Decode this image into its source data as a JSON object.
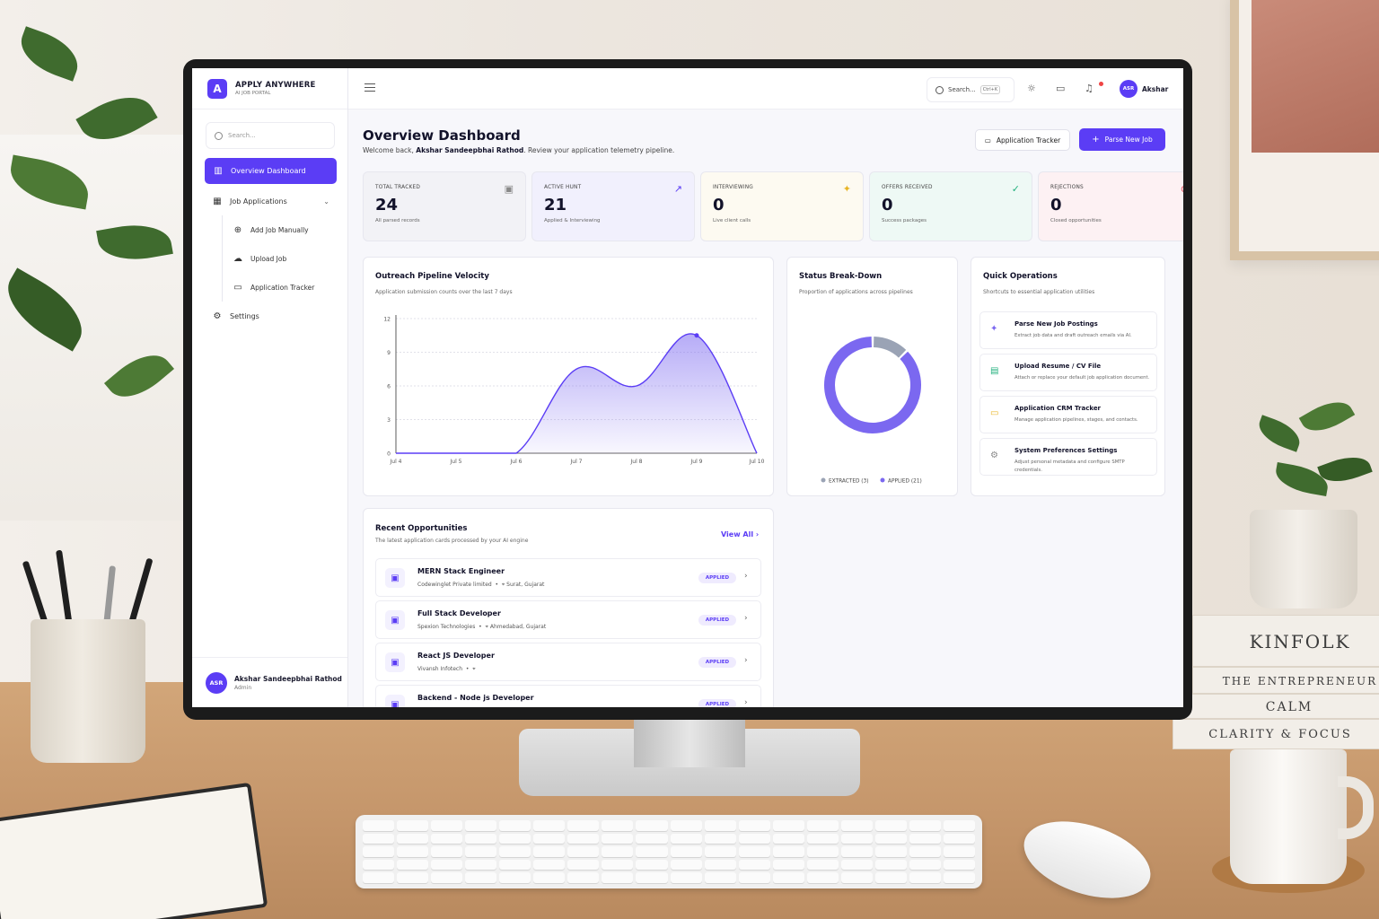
{
  "app": {
    "brand_name": "APPLY ANYWHERE",
    "brand_sub": "AI JOB PORTAL",
    "brand_letter": "A"
  },
  "sidebar": {
    "search_placeholder": "Search...",
    "items": [
      {
        "label": "Overview Dashboard",
        "icon": "bar-chart-icon",
        "active": true
      },
      {
        "label": "Job Applications",
        "icon": "grid-icon"
      },
      {
        "label": "Add Job Manually",
        "icon": "plus-circle-icon"
      },
      {
        "label": "Upload Job",
        "icon": "cloud-upload-icon"
      },
      {
        "label": "Application Tracker",
        "icon": "card-icon"
      },
      {
        "label": "Settings",
        "icon": "gear-icon"
      }
    ],
    "user": {
      "initials": "ASR",
      "name": "Akshar Sandeepbhai Rathod",
      "role": "Admin"
    }
  },
  "topbar": {
    "search_label": "Search...",
    "shortcut": "Ctrl+K",
    "user_initials": "ASR",
    "user_name": "Akshar"
  },
  "header": {
    "title": "Overview Dashboard",
    "welcome_prefix": "Welcome back, ",
    "welcome_name": "Akshar Sandeepbhai Rathod",
    "welcome_suffix": ". Review your application telemetry pipeline.",
    "tracker_button": "Application Tracker",
    "parse_button": "Parse New Job"
  },
  "stats": [
    {
      "label": "TOTAL TRACKED",
      "value": "24",
      "sub": "All parsed records",
      "bg": "#f2f2f6",
      "icon": "briefcase-icon"
    },
    {
      "label": "ACTIVE HUNT",
      "value": "21",
      "sub": "Applied & Interviewing",
      "bg": "#f1f0fd",
      "icon": "trend-up-icon"
    },
    {
      "label": "INTERVIEWING",
      "value": "0",
      "sub": "Live client calls",
      "bg": "#fdfaf1",
      "icon": "sparkle-icon"
    },
    {
      "label": "OFFERS RECEIVED",
      "value": "0",
      "sub": "Success packages",
      "bg": "#eef9f5",
      "icon": "check-circle-icon"
    },
    {
      "label": "REJECTIONS",
      "value": "0",
      "sub": "Closed opportunities",
      "bg": "#fdf1f3",
      "icon": "x-circle-icon"
    }
  ],
  "velocity": {
    "title": "Outreach Pipeline Velocity",
    "subtitle": "Application submission counts over the last 7 days"
  },
  "chart_data": [
    {
      "type": "area",
      "title": "Outreach Pipeline Velocity",
      "x": [
        "Jul 4",
        "Jul 5",
        "Jul 6",
        "Jul 7",
        "Jul 8",
        "Jul 9",
        "Jul 10"
      ],
      "series": [
        {
          "values": [
            0,
            0,
            0,
            7.5,
            6,
            10.5,
            0
          ]
        }
      ],
      "yticks": [
        0,
        3,
        6,
        9,
        12
      ],
      "ylim": [
        0,
        12
      ],
      "grid": true,
      "color": "#5b3df5"
    },
    {
      "type": "pie",
      "title": "Status Break-Down",
      "slices": [
        {
          "label": "EXTRACTED",
          "value": 3,
          "color": "#9aa3b5"
        },
        {
          "label": "APPLIED",
          "value": 21,
          "color": "#7b68f0"
        }
      ]
    }
  ],
  "breakdown": {
    "title": "Status Break-Down",
    "subtitle": "Proportion of applications across pipelines",
    "legend": [
      "EXTRACTED (3)",
      "APPLIED (21)"
    ]
  },
  "quick": {
    "title": "Quick Operations",
    "subtitle": "Shortcuts to essential application utilities",
    "items": [
      {
        "title": "Parse New Job Postings",
        "desc": "Extract job data and draft outreach emails via AI.",
        "icon": "sparkle-icon",
        "color": "#7b68f0"
      },
      {
        "title": "Upload Resume / CV File",
        "desc": "Attach or replace your default job application document.",
        "icon": "file-icon",
        "color": "#22b07d"
      },
      {
        "title": "Application CRM Tracker",
        "desc": "Manage application pipelines, stages, and contacts.",
        "icon": "card-icon",
        "color": "#e8b425"
      },
      {
        "title": "System Preferences Settings",
        "desc": "Adjust personal metadata and configure SMTP credentials.",
        "icon": "gear-icon",
        "color": "#888"
      }
    ]
  },
  "recent": {
    "title": "Recent Opportunities",
    "subtitle": "The latest application cards processed by your AI engine",
    "view_all": "View All",
    "items": [
      {
        "title": "MERN Stack Engineer",
        "company": "Codewinglet Private limited",
        "location": "Surat, Gujarat",
        "status": "APPLIED"
      },
      {
        "title": "Full Stack Developer",
        "company": "Spexion Technologies",
        "location": "Ahmedabad, Gujarat",
        "status": "APPLIED"
      },
      {
        "title": "React JS Developer",
        "company": "Vivansh Infotech",
        "location": "",
        "status": "APPLIED"
      },
      {
        "title": "Backend - Node js Developer",
        "company": "",
        "location": "",
        "status": "APPLIED"
      }
    ]
  },
  "desk": {
    "books": [
      "KINFOLK",
      "THE ENTREPRENEUR",
      "CALM",
      "CLARITY & FOCUS"
    ]
  }
}
